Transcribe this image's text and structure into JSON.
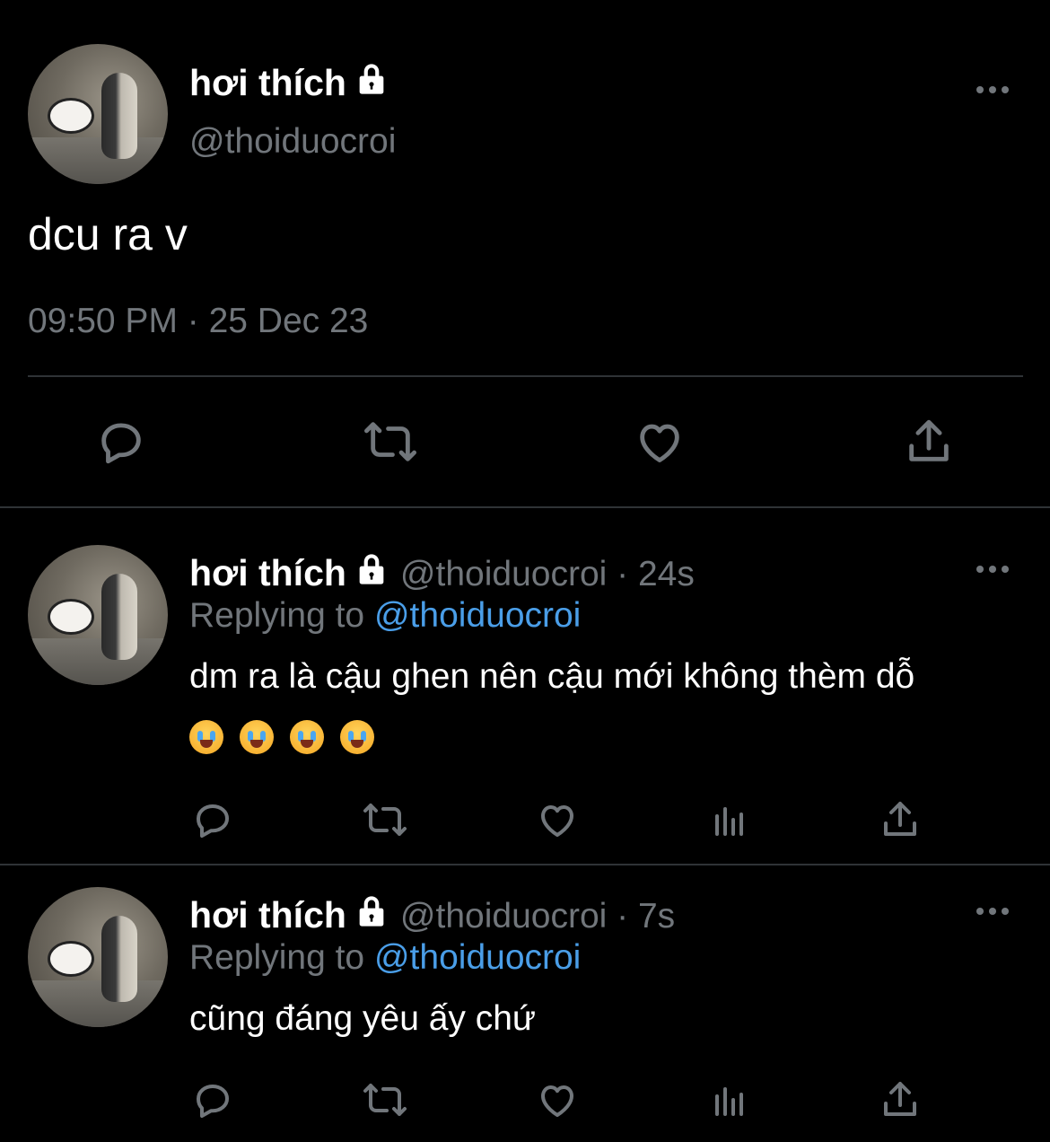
{
  "main_tweet": {
    "display_name": "hơi thích",
    "handle": "@thoiduocroi",
    "text": "dcu ra v",
    "timestamp": "09:50 PM · 25 Dec 23"
  },
  "replies": [
    {
      "display_name": "hơi thích",
      "meta": "@thoiduocroi · 24s",
      "replying_prefix": "Replying to",
      "replying_handle": "@thoiduocroi",
      "text": "dm ra là cậu ghen nên cậu mới không thèm dỗ",
      "emoji_line": [
        "loudly-crying-face",
        "loudly-crying-face",
        "loudly-crying-face",
        "loudly-crying-face"
      ]
    },
    {
      "display_name": "hơi thích",
      "meta": "@thoiduocroi · 7s",
      "replying_prefix": "Replying to",
      "replying_handle": "@thoiduocroi",
      "text": "cũng đáng yêu ấy chứ"
    }
  ],
  "colors": {
    "background": "#000000",
    "text_primary": "#ffffff",
    "text_secondary": "#71767b",
    "link": "#4a9ee8",
    "divider": "#2f3336"
  },
  "icons": [
    "lock-icon",
    "more-icon",
    "reply-icon",
    "retweet-icon",
    "like-icon",
    "views-icon",
    "share-icon"
  ]
}
